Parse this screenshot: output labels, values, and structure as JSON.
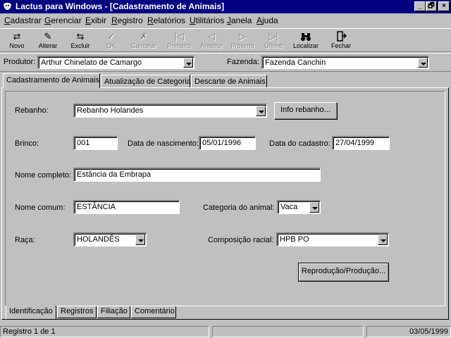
{
  "window": {
    "title": "Lactus para Windows - [Cadastramento de Animais]",
    "controls": [
      "_",
      "🗗",
      "×"
    ]
  },
  "menu": {
    "items": [
      {
        "hot": "C",
        "rest": "adastrar"
      },
      {
        "hot": "G",
        "rest": "erenciar"
      },
      {
        "hot": "E",
        "rest": "xibir"
      },
      {
        "hot": "R",
        "rest": "egistro"
      },
      {
        "hot": "R",
        "rest": "elatórios"
      },
      {
        "hot": "U",
        "rest": "tilitários"
      },
      {
        "hot": "J",
        "rest": "anela"
      },
      {
        "hot": "A",
        "rest": "juda"
      }
    ]
  },
  "toolbar": {
    "items": [
      {
        "label": "Novo",
        "icon": "new-icon",
        "glyph": "⇄",
        "enabled": true
      },
      {
        "label": "Alterar",
        "icon": "edit-icon",
        "glyph": "✎",
        "enabled": true
      },
      {
        "label": "Excluir",
        "icon": "delete-icon",
        "glyph": "⇆",
        "enabled": true
      },
      {
        "label": "OK",
        "icon": "ok-icon",
        "glyph": "✓",
        "enabled": false
      },
      {
        "label": "Cancelar",
        "icon": "cancel-icon",
        "glyph": "✗",
        "enabled": false
      },
      {
        "label": "Primeiro",
        "icon": "first-icon",
        "glyph": "|◁",
        "enabled": false
      },
      {
        "label": "Anterior",
        "icon": "previous-icon",
        "glyph": "◁",
        "enabled": false
      },
      {
        "label": "Próximo",
        "icon": "next-icon",
        "glyph": "▷",
        "enabled": false
      },
      {
        "label": "Último",
        "icon": "last-icon",
        "glyph": "▷|",
        "enabled": false
      },
      {
        "label": "Localizar",
        "icon": "binoculars-icon",
        "glyph": "🔍",
        "enabled": true
      },
      {
        "label": "Fechar",
        "icon": "close-door-icon",
        "glyph": "⍈",
        "enabled": true
      }
    ]
  },
  "context": {
    "produtor_label": "Produtor:",
    "produtor_value": "Arthur Chinelato de Camargo",
    "fazenda_label": "Fazenda:",
    "fazenda_value": "Fazenda Canchin"
  },
  "tabs": {
    "top": [
      "Cadastramento de Animais",
      "Atualização de Categoria",
      "Descarte de Animais"
    ],
    "bottom": [
      "Identificação",
      "Registros",
      "Filiação",
      "Comentário"
    ]
  },
  "form": {
    "rebanho_label": "Rebanho:",
    "rebanho_value": "Rebanho Holandes",
    "info_rebanho_button": "Info rebanho...",
    "brinco_label": "Brinco:",
    "brinco_value": "001",
    "nascimento_label": "Data de nascimento:",
    "nascimento_value": "05/01/1996",
    "cadastro_label": "Data do cadastro:",
    "cadastro_value": "27/04/1999",
    "nome_completo_label": "Nome completo:",
    "nome_completo_value": "Estância da Embrapa",
    "nome_comum_label": "Nome comum:",
    "nome_comum_value": "ESTÂNCIA",
    "categoria_label": "Categoria do animal:",
    "categoria_value": "Vaca",
    "raca_label": "Raça:",
    "raca_value": "HOLANDÊS",
    "composicao_label": "Composição racial:",
    "composicao_value": "HPB PO",
    "reproducao_button": "Reprodução/Produção..."
  },
  "status": {
    "record": "Registro 1 de 1",
    "date": "03/05/1999"
  }
}
